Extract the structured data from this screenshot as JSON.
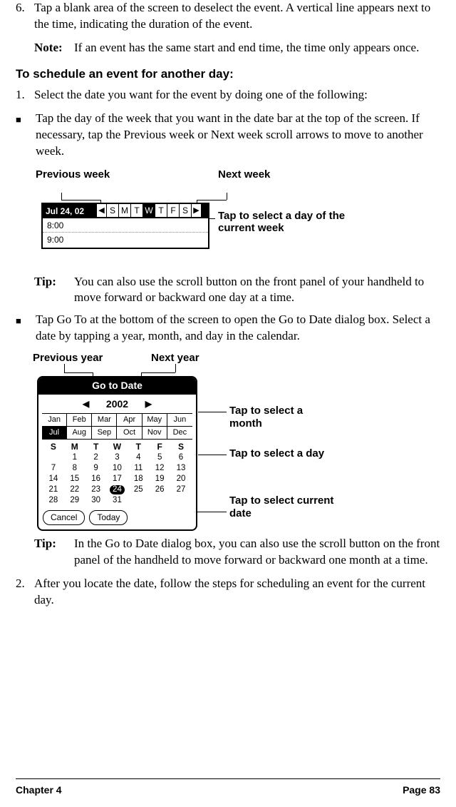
{
  "step6": {
    "num": "6.",
    "text": "Tap a blank area of the screen to deselect the event. A vertical line appears next to the time, indicating the duration of the event."
  },
  "note1": {
    "label": "Note:",
    "text": "If an event has the same start and end time, the time only appears once."
  },
  "heading1": "To schedule an event for another day:",
  "step1": {
    "num": "1.",
    "text": "Select the date you want for the event by doing one of the following:"
  },
  "bullet1": "Tap the day of the week that you want in the date bar at the top of the screen. If necessary, tap the Previous week or Next week scroll arrows to move to another week.",
  "fig1": {
    "prev_week": "Previous week",
    "next_week": "Next week",
    "tap_day": "Tap to select a day of the current week",
    "date": "Jul 24, 02",
    "days": [
      "S",
      "M",
      "T",
      "W",
      "T",
      "F",
      "S"
    ],
    "selected_day_index": 3,
    "arrow_left": "◀",
    "arrow_right": "▶",
    "times": [
      "8:00",
      "9:00"
    ]
  },
  "tip1": {
    "label": "Tip:",
    "text": "You can also use the scroll button on the front panel of your handheld to move forward or backward one day at a time."
  },
  "bullet2": "Tap Go To at the bottom of the screen to open the Go to Date dialog box. Select a date by tapping a year, month, and day in the calendar.",
  "fig2": {
    "prev_year": "Previous year",
    "next_year": "Next year",
    "tap_month": "Tap to select a month",
    "tap_day": "Tap to select a day",
    "tap_today": "Tap to select current date",
    "title": "Go to Date",
    "year": "2002",
    "arrow_left": "◀",
    "arrow_right": "▶",
    "months": [
      "Jan",
      "Feb",
      "Mar",
      "Apr",
      "May",
      "Jun",
      "Jul",
      "Aug",
      "Sep",
      "Oct",
      "Nov",
      "Dec"
    ],
    "selected_month_index": 6,
    "dow": [
      "S",
      "M",
      "T",
      "W",
      "T",
      "F",
      "S"
    ],
    "days": [
      "",
      "1",
      "2",
      "3",
      "4",
      "5",
      "6",
      "7",
      "8",
      "9",
      "10",
      "11",
      "12",
      "13",
      "14",
      "15",
      "16",
      "17",
      "18",
      "19",
      "20",
      "21",
      "22",
      "23",
      "24",
      "25",
      "26",
      "27",
      "28",
      "29",
      "30",
      "31",
      "",
      "",
      ""
    ],
    "today_value": "24",
    "cancel": "Cancel",
    "today": "Today"
  },
  "tip2": {
    "label": "Tip:",
    "text": "In the Go to Date dialog box, you can also use the scroll button on the front panel of the handheld to move forward or backward one month at a time."
  },
  "step2": {
    "num": "2.",
    "text": "After you locate the date, follow the steps for scheduling an event for the current day."
  },
  "footer": {
    "chapter": "Chapter 4",
    "page": "Page 83"
  }
}
